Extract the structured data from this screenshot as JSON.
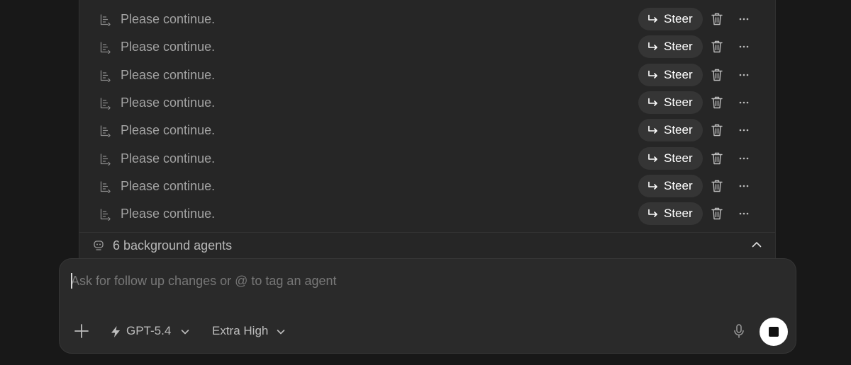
{
  "queue": {
    "items": [
      {
        "text": "Please continue.",
        "steer_label": "Steer"
      },
      {
        "text": "Please continue.",
        "steer_label": "Steer"
      },
      {
        "text": "Please continue.",
        "steer_label": "Steer"
      },
      {
        "text": "Please continue.",
        "steer_label": "Steer"
      },
      {
        "text": "Please continue.",
        "steer_label": "Steer"
      },
      {
        "text": "Please continue.",
        "steer_label": "Steer"
      },
      {
        "text": "Please continue.",
        "steer_label": "Steer"
      },
      {
        "text": "Please continue.",
        "steer_label": "Steer"
      }
    ],
    "row_icon": "queued-message-icon",
    "steer_icon": "return-arrow-icon",
    "delete_icon": "trash-icon",
    "more_icon": "more-dots-icon"
  },
  "background_agents": {
    "label": "6 background agents",
    "icon": "agent-robot-icon",
    "toggle_icon": "chevron-up-icon"
  },
  "composer": {
    "placeholder": "Ask for follow up changes or @ to tag an agent",
    "value": "",
    "model": "GPT-5.4",
    "effort": "Extra High",
    "icons": {
      "add": "plus-icon",
      "model": "bolt-icon",
      "mic": "microphone-icon",
      "stop": "stop-icon"
    }
  },
  "colors": {
    "background": "#181818",
    "panel": "#262626",
    "composer": "#2a2a2a",
    "steer_button": "#353535",
    "text_muted": "#a3a3a3",
    "text_primary": "#ffffff"
  }
}
